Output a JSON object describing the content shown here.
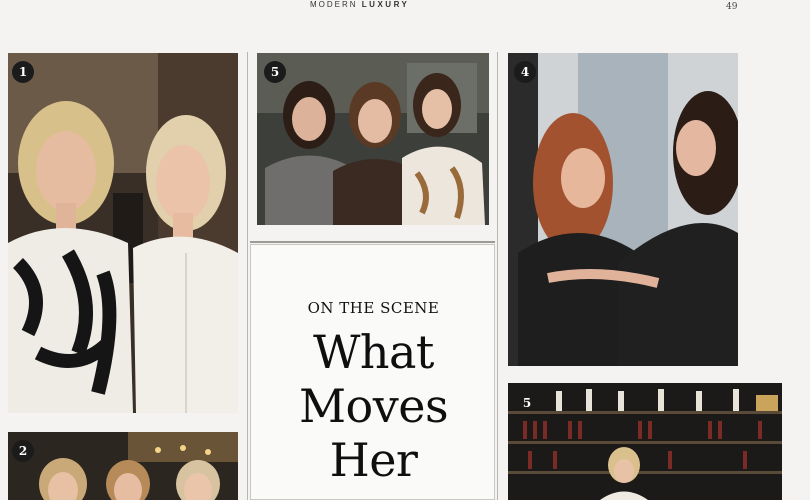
{
  "masthead": {
    "prefix": "MODERN",
    "suffix": "LUXURY"
  },
  "page_number": "49",
  "photos": [
    {
      "badge": "1"
    },
    {
      "badge": "5"
    },
    {
      "badge": "4"
    },
    {
      "badge": "2"
    },
    {
      "badge": "5"
    }
  ],
  "feature": {
    "kicker": "ON THE SCENE",
    "headline_line1": "What",
    "headline_line2": "Moves",
    "headline_line3": "Her"
  },
  "colors": {
    "paper": "#f4f3f1",
    "ink": "#111111",
    "badge": "#1b1b1b"
  }
}
